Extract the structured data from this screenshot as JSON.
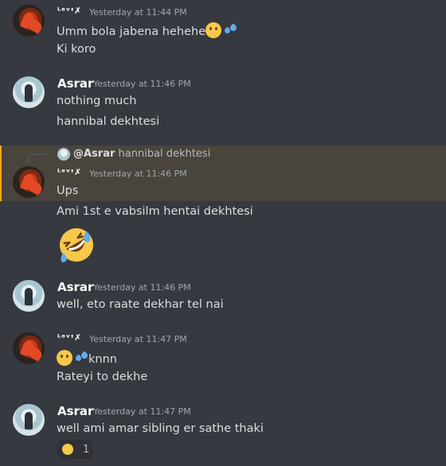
{
  "messages": [
    {
      "user": "ᴸᵉᵛᶦ✗",
      "time": "Yesterday at 11:44 PM",
      "lines": [
        "Umm bola jabena hehehe",
        "Ki koro"
      ]
    },
    {
      "user": "Asrar",
      "time": "Yesterday at 11:46 PM",
      "lines": [
        "nothing much",
        "hannibal dekhtesi"
      ]
    },
    {
      "user": "ᴸᵉᵛᶦ✗",
      "time": "Yesterday at 11:46 PM",
      "reply": {
        "who": "@Asrar",
        "text": "hannibal dekhtesi"
      },
      "lines": [
        "Ups",
        "Ami 1st e vabsilm hentai dekhtesi"
      ],
      "emoji": "rolling-on-floor-laughing"
    },
    {
      "user": "Asrar",
      "time": "Yesterday at 11:46 PM",
      "lines": [
        "well, eto raate dekhar tel nai"
      ]
    },
    {
      "user": "ᴸᵉᵛᶦ✗",
      "time": "Yesterday at 11:47 PM",
      "lines": [
        "knnn",
        "Rateyi to dekhe"
      ]
    },
    {
      "user": "Asrar",
      "time": "Yesterday at 11:47 PM",
      "lines": [
        "well ami amar sibling er sathe thaki"
      ],
      "reaction": {
        "emoji": "weary-face",
        "count": "1"
      }
    }
  ],
  "colors": {
    "background": "#36393f",
    "reply_highlight": "#49443c",
    "username": "#ffffff",
    "timestamp": "#a3a6aa",
    "text": "#dcddde"
  }
}
